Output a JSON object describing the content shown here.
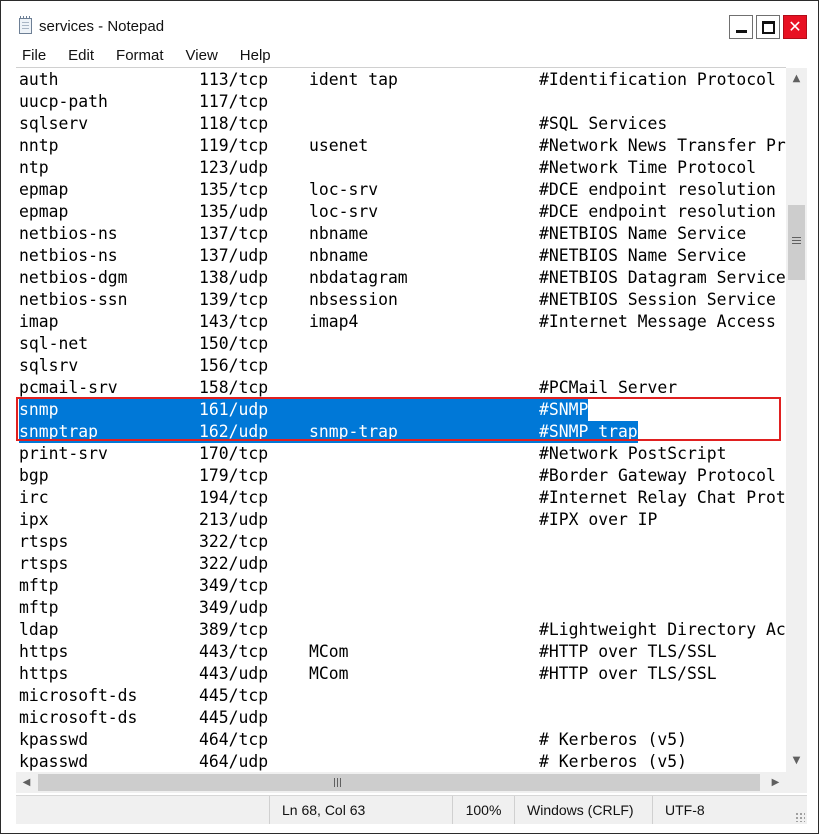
{
  "window": {
    "title": "services - Notepad",
    "close_glyph": "✕"
  },
  "menu": [
    "File",
    "Edit",
    "Format",
    "View",
    "Help"
  ],
  "lines": [
    {
      "name": "auth",
      "port": "113/tcp",
      "aliases": "ident tap",
      "comment": "#Identification Protocol"
    },
    {
      "name": "uucp-path",
      "port": "117/tcp",
      "aliases": "",
      "comment": ""
    },
    {
      "name": "sqlserv",
      "port": "118/tcp",
      "aliases": "",
      "comment": "#SQL Services"
    },
    {
      "name": "nntp",
      "port": "119/tcp",
      "aliases": "usenet",
      "comment": "#Network News Transfer Pr"
    },
    {
      "name": "ntp",
      "port": "123/udp",
      "aliases": "",
      "comment": "#Network Time Protocol"
    },
    {
      "name": "epmap",
      "port": "135/tcp",
      "aliases": "loc-srv",
      "comment": "#DCE endpoint resolution"
    },
    {
      "name": "epmap",
      "port": "135/udp",
      "aliases": "loc-srv",
      "comment": "#DCE endpoint resolution"
    },
    {
      "name": "netbios-ns",
      "port": "137/tcp",
      "aliases": "nbname",
      "comment": "#NETBIOS Name Service"
    },
    {
      "name": "netbios-ns",
      "port": "137/udp",
      "aliases": "nbname",
      "comment": "#NETBIOS Name Service"
    },
    {
      "name": "netbios-dgm",
      "port": "138/udp",
      "aliases": "nbdatagram",
      "comment": "#NETBIOS Datagram Service"
    },
    {
      "name": "netbios-ssn",
      "port": "139/tcp",
      "aliases": "nbsession",
      "comment": "#NETBIOS Session Service"
    },
    {
      "name": "imap",
      "port": "143/tcp",
      "aliases": "imap4",
      "comment": "#Internet Message Access"
    },
    {
      "name": "sql-net",
      "port": "150/tcp",
      "aliases": "",
      "comment": ""
    },
    {
      "name": "sqlsrv",
      "port": "156/tcp",
      "aliases": "",
      "comment": ""
    },
    {
      "name": "pcmail-srv",
      "port": "158/tcp",
      "aliases": "",
      "comment": "#PCMail Server"
    },
    {
      "name": "snmp",
      "port": "161/udp",
      "aliases": "",
      "comment": "#SNMP",
      "selected": true
    },
    {
      "name": "snmptrap",
      "port": "162/udp",
      "aliases": "snmp-trap",
      "comment": "#SNMP trap",
      "selected": true
    },
    {
      "name": "print-srv",
      "port": "170/tcp",
      "aliases": "",
      "comment": "#Network PostScript"
    },
    {
      "name": "bgp",
      "port": "179/tcp",
      "aliases": "",
      "comment": "#Border Gateway Protocol"
    },
    {
      "name": "irc",
      "port": "194/tcp",
      "aliases": "",
      "comment": "#Internet Relay Chat Prot"
    },
    {
      "name": "ipx",
      "port": "213/udp",
      "aliases": "",
      "comment": "#IPX over IP"
    },
    {
      "name": "rtsps",
      "port": "322/tcp",
      "aliases": "",
      "comment": ""
    },
    {
      "name": "rtsps",
      "port": "322/udp",
      "aliases": "",
      "comment": ""
    },
    {
      "name": "mftp",
      "port": "349/tcp",
      "aliases": "",
      "comment": ""
    },
    {
      "name": "mftp",
      "port": "349/udp",
      "aliases": "",
      "comment": ""
    },
    {
      "name": "ldap",
      "port": "389/tcp",
      "aliases": "",
      "comment": "#Lightweight Directory Ac"
    },
    {
      "name": "https",
      "port": "443/tcp",
      "aliases": "MCom",
      "comment": "#HTTP over TLS/SSL"
    },
    {
      "name": "https",
      "port": "443/udp",
      "aliases": "MCom",
      "comment": "#HTTP over TLS/SSL"
    },
    {
      "name": "microsoft-ds",
      "port": "445/tcp",
      "aliases": "",
      "comment": ""
    },
    {
      "name": "microsoft-ds",
      "port": "445/udp",
      "aliases": "",
      "comment": ""
    },
    {
      "name": "kpasswd",
      "port": "464/tcp",
      "aliases": "",
      "comment": "# Kerberos (v5)"
    },
    {
      "name": "kpasswd",
      "port": "464/udp",
      "aliases": "",
      "comment": "# Kerberos (v5)"
    }
  ],
  "status": {
    "position": "Ln 68, Col 63",
    "zoom": "100%",
    "line_ending": "Windows (CRLF)",
    "encoding": "UTF-8"
  },
  "colors": {
    "selection": "#0078d7",
    "highlight_border": "#e02020",
    "close_button": "#e81123"
  }
}
